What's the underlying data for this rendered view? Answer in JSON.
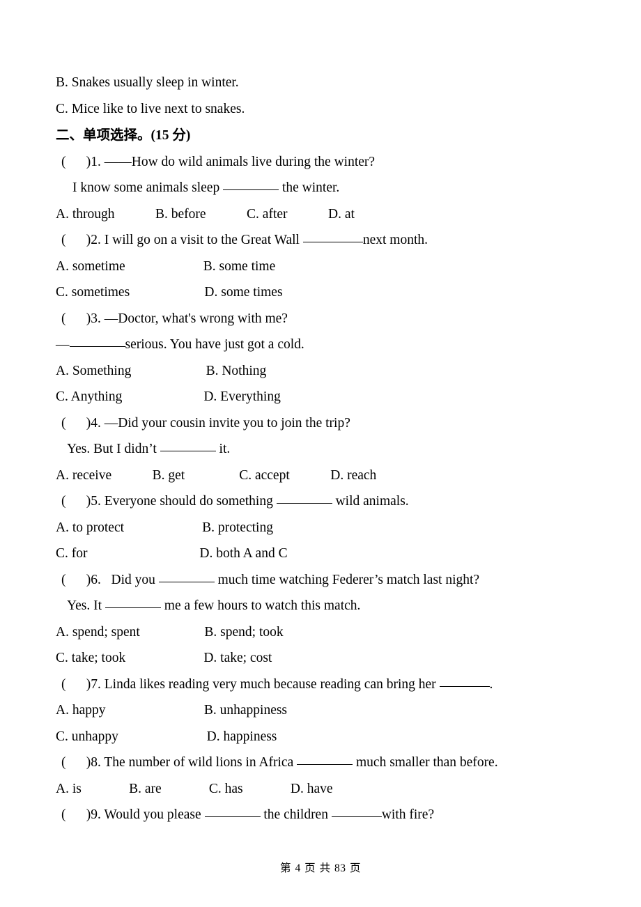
{
  "document": {
    "lines": [
      {
        "id": "l1",
        "text": "B. Snakes usually sleep in winter."
      },
      {
        "id": "l2",
        "text": "C. Mice like to live next to snakes."
      }
    ],
    "section_heading": {
      "title": "二、单项选择。",
      "score": "(15 分)"
    },
    "questions": [
      {
        "num": "1",
        "stem_prefix": "(      )1. ——How do wild animals live during the winter?",
        "stem_second": "I know some animals sleep ",
        "stem_second_tail": " the winter.",
        "options_inline": "A. through            B. before            C. after            D. at",
        "options_a": "",
        "options_b": ""
      },
      {
        "num": "2",
        "stem_prefix": "(      )2. I will go on a visit to the Great Wall ",
        "stem_prefix_tail": "next month.",
        "options_a": "A. sometime                       B. some time",
        "options_b": "C. sometimes                      D. some times"
      },
      {
        "num": "3",
        "stem_prefix": "(      )3. —Doctor, what's wrong with me?",
        "stem_second_lead": "—",
        "stem_second_tail": "serious. You have just got a cold.",
        "options_a": "A. Something                      B. Nothing",
        "options_b": "C. Anything                        D. Everything"
      },
      {
        "num": "4",
        "stem_prefix": "(      )4. —Did your cousin invite you to join the trip?",
        "stem_second": "Yes. But I didn’t ",
        "stem_second_tail": " it.",
        "options_inline": "A. receive            B. get                C. accept            D. reach"
      },
      {
        "num": "5",
        "stem_prefix": "(      )5. Everyone should do something ",
        "stem_prefix_tail": " wild animals.",
        "options_a": "A. to protect                       B. protecting",
        "options_b": "C. for                                 D. both A and C"
      },
      {
        "num": "6",
        "stem_prefix": "(      )6.   Did you ",
        "stem_prefix_tail": " much time watching Federer’s match last night?",
        "stem_second": "Yes. It ",
        "stem_second_tail": " me a few hours to watch this match.",
        "options_a": "A. spend; spent                   B. spend; took",
        "options_b": "C. take; took                       D. take; cost"
      },
      {
        "num": "7",
        "stem_prefix": "(      )7. Linda likes reading very much because reading can bring her ",
        "stem_prefix_tail": ".",
        "options_a": "A. happy                             B. unhappiness",
        "options_b": "C. unhappy                          D. happiness"
      },
      {
        "num": "8",
        "stem_prefix": "(      )8. The number of wild lions in Africa ",
        "stem_prefix_tail": " much smaller than before.",
        "options_inline": "A. is              B. are              C. has              D. have"
      },
      {
        "num": "9",
        "stem_prefix": "(      )9. Would you please ",
        "stem_mid": " the children ",
        "stem_prefix_tail": "with fire?"
      }
    ]
  },
  "footer": {
    "prefix": "第",
    "page": "4",
    "middle": "页 共",
    "total": "83",
    "suffix": "页"
  }
}
